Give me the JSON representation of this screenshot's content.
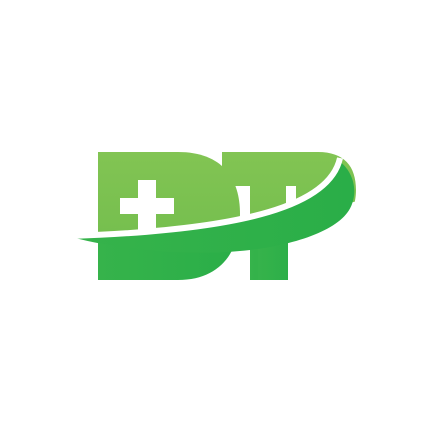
{
  "logo": {
    "wordmark": "DTP",
    "icon": "medical-cross-icon",
    "swoosh": "swoosh-icon",
    "colors": {
      "light_green": "#7DC14F",
      "dark_green": "#2EB14A",
      "background": "#FFFFFF"
    }
  }
}
